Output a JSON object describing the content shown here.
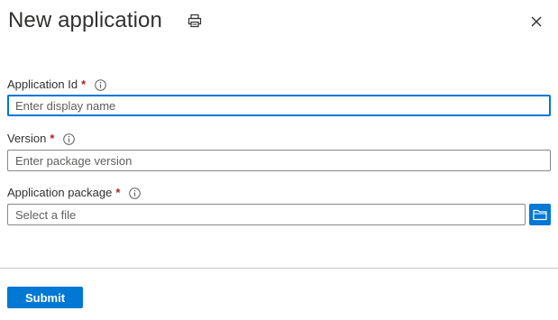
{
  "header": {
    "title": "New application",
    "print_icon": "print-icon",
    "close_icon": "close-icon"
  },
  "form": {
    "application_id": {
      "label": "Application Id",
      "required_marker": "*",
      "placeholder": "Enter display name",
      "value": ""
    },
    "version": {
      "label": "Version",
      "required_marker": "*",
      "placeholder": "Enter package version",
      "value": ""
    },
    "package": {
      "label": "Application package",
      "required_marker": "*",
      "placeholder": "Select a file",
      "value": "",
      "browse_icon": "folder-icon"
    }
  },
  "footer": {
    "submit_label": "Submit"
  },
  "colors": {
    "accent": "#0078d4",
    "required": "#a4262c",
    "text": "#323130",
    "border": "#8a8886"
  }
}
